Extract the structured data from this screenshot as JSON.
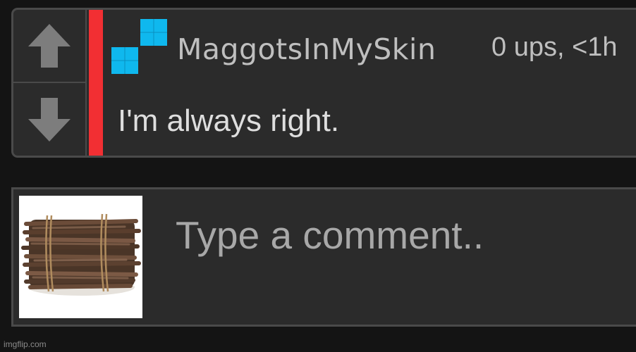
{
  "comment": {
    "username": "MaggotsInMySkin",
    "meta": "0 ups, <1h",
    "text": "I'm always right.",
    "rank_color": "#f22f33",
    "icons": {
      "upvote": "arrow-up-icon",
      "downvote": "arrow-down-icon",
      "user_badge": "pixel-blocks-icon"
    }
  },
  "compose": {
    "placeholder": "Type a comment..",
    "avatar": "bundle-of-sticks-image"
  },
  "watermark": "imgflip.com",
  "colors": {
    "background": "#141414",
    "card": "#2b2b2b",
    "border": "#4a4a4a",
    "badge": "#0fb8ee"
  }
}
